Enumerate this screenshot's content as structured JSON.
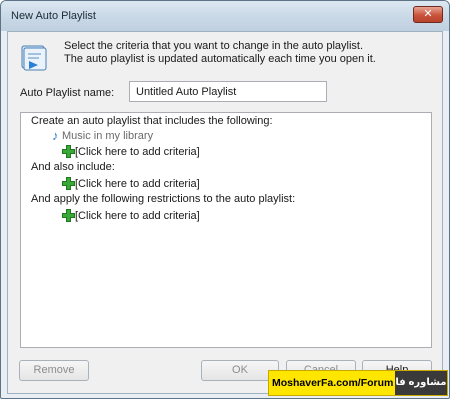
{
  "window": {
    "title": "New Auto Playlist",
    "close_glyph": "✕"
  },
  "intro": {
    "icon": "playlist-wizard-icon",
    "line1": "Select the criteria that you want to change in the auto playlist.",
    "line2": "The auto playlist is updated automatically each time you open it."
  },
  "name_field": {
    "label": "Auto Playlist name:",
    "value": "Untitled Auto Playlist"
  },
  "criteria": {
    "heading1": "Create an auto playlist that includes the following:",
    "music_library": "Music in my library",
    "add1": "[Click here to add criteria]",
    "heading2": "And also include:",
    "add2": "[Click here to add criteria]",
    "heading3": "And apply the following restrictions to the auto playlist:",
    "add3": "[Click here to add criteria]"
  },
  "buttons": {
    "remove": "Remove",
    "ok": "OK",
    "cancel": "Cancel",
    "help": "Help"
  },
  "watermark": {
    "site": "MoshaverFa.com/Forum",
    "badge": "تالار مشاوره فا"
  },
  "colors": {
    "accent_blue": "#2b7fd4",
    "plus_green": "#3aa836",
    "watermark_yellow": "#ffe600"
  }
}
